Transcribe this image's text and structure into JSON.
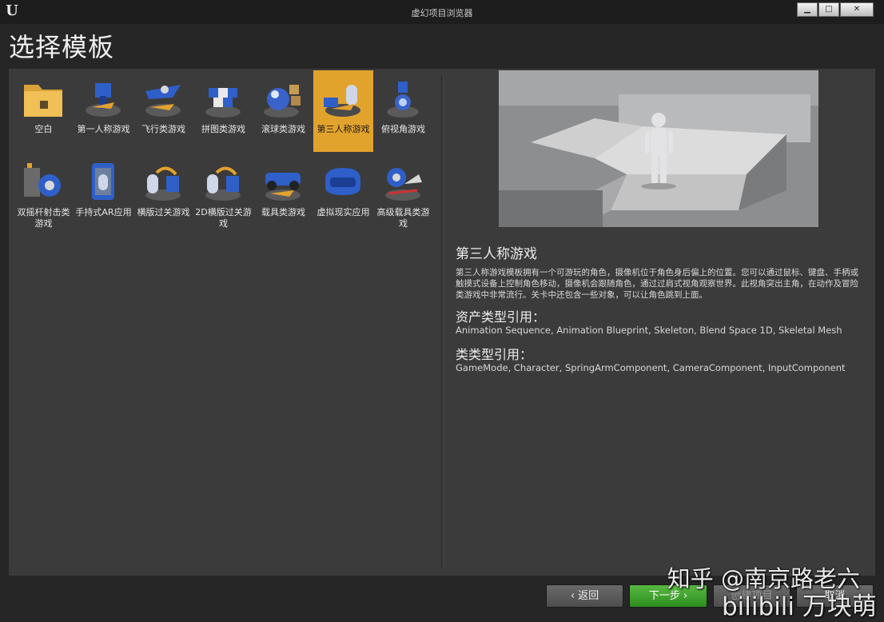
{
  "window": {
    "title": "虚幻项目浏览器",
    "logo": "unreal-engine-logo",
    "buttons": {
      "minimize": "▁",
      "maximize": "□",
      "close": "✕"
    }
  },
  "page": {
    "title": "选择模板"
  },
  "templates": [
    {
      "label": "空白",
      "icon": "folder-icon"
    },
    {
      "label": "第一人称游戏",
      "icon": "first-person-icon"
    },
    {
      "label": "飞行类游戏",
      "icon": "flying-icon"
    },
    {
      "label": "拼图类游戏",
      "icon": "puzzle-icon"
    },
    {
      "label": "滚球类游戏",
      "icon": "rolling-ball-icon"
    },
    {
      "label": "第三人称游戏",
      "icon": "third-person-icon"
    },
    {
      "label": "俯视角游戏",
      "icon": "top-down-icon"
    },
    {
      "label": "双摇杆射击类游戏",
      "icon": "twin-stick-icon"
    },
    {
      "label": "手持式AR应用",
      "icon": "handheld-ar-icon"
    },
    {
      "label": "横版过关游戏",
      "icon": "side-scroller-icon"
    },
    {
      "label": "2D横版过关游戏",
      "icon": "side-scroller-2d-icon"
    },
    {
      "label": "载具类游戏",
      "icon": "vehicle-icon"
    },
    {
      "label": "虚拟现实应用",
      "icon": "vr-headset-icon"
    },
    {
      "label": "高级载具类游戏",
      "icon": "advanced-vehicle-icon"
    }
  ],
  "selected_index": 5,
  "detail": {
    "name": "第三人称游戏",
    "description": "第三人称游戏模板拥有一个可游玩的角色，摄像机位于角色身后偏上的位置。您可以通过鼠标、键盘、手柄或触摸式设备上控制角色移动，摄像机会跟随角色，通过过肩式视角观察世界。此视角突出主角，在动作及冒险类游戏中非常流行。关卡中还包含一些对象，可以让角色跳到上面。",
    "asset_heading": "资产类型引用：",
    "asset_refs": "Animation Sequence, Animation Blueprint, Skeleton, Blend Space 1D, Skeletal Mesh",
    "class_heading": "类类型引用：",
    "class_refs": "GameMode, Character, SpringArmComponent, CameraComponent, InputComponent"
  },
  "buttons": {
    "back": "返回",
    "next": "下一步",
    "create": "创建项目",
    "cancel": "取消"
  },
  "next_arrow": "›",
  "back_arrow": "‹",
  "watermarks": {
    "zhihu": "知乎 @南京路老六",
    "bilibili": "bilibili 万块萌"
  }
}
